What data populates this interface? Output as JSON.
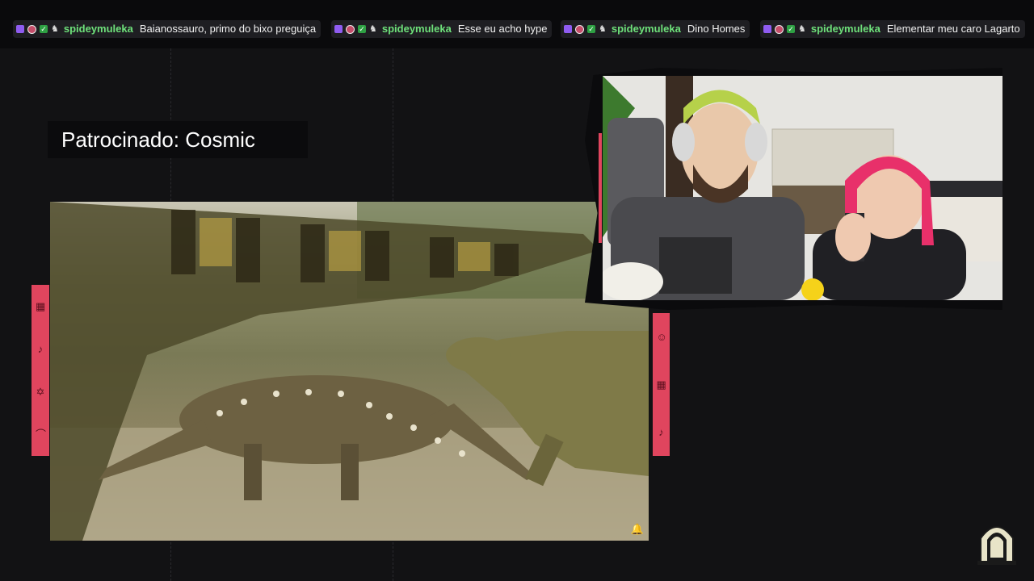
{
  "chat": {
    "messages": [
      {
        "user": "spideymuleka",
        "text": "Baianossauro, primo do bixo preguiça"
      },
      {
        "user": "spideymuleka",
        "text": "Esse eu acho hype"
      },
      {
        "user": "spideymuleka",
        "text": "Dino Homes"
      },
      {
        "user": "spideymuleka",
        "text": "Elementar meu caro Lagarto"
      }
    ],
    "badges": [
      "twitch-badge-icon",
      "avatar-icon",
      "verified-check-icon",
      "ghost-icon"
    ]
  },
  "overlay": {
    "sponsor_label": "Patrocinado: Cosmic"
  },
  "icons": {
    "left_strip": [
      "calendar-icon",
      "spoon-icon",
      "pentagram-icon",
      "spoon-icon"
    ],
    "right_strip": [
      "smile-icon",
      "calendar-icon",
      "spoon-icon"
    ],
    "logo": "crypt-logo-icon",
    "video_corner": "bell-icon"
  },
  "colors": {
    "accent_red": "#e0455e",
    "chat_username": "#6ee07a",
    "background": "#121214"
  }
}
